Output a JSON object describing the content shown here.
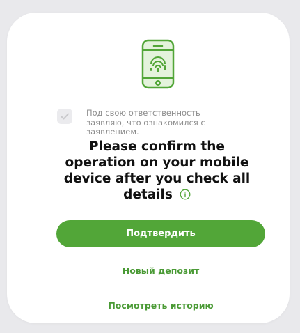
{
  "consent": {
    "checked": true,
    "text_line1": "Под свою ответственность",
    "text_line2": "заявляю, что ознакомился с",
    "text_line3": "заявлением."
  },
  "confirm": {
    "line1": "Please confirm the",
    "line2": "operation on your mobile",
    "line3": "device after you check all",
    "line4": "details"
  },
  "actions": {
    "confirm_button_label": "Подтвердить",
    "new_deposit_label": "Новый депозит",
    "view_history_label": "Посмотреть историю"
  },
  "icons": {
    "top": "phone-fingerprint-icon",
    "checkbox": "checkmark-icon",
    "info": "info-icon"
  },
  "colors": {
    "accent": "#52a638",
    "link": "#4a9a35",
    "background": "#e9e9ec"
  }
}
